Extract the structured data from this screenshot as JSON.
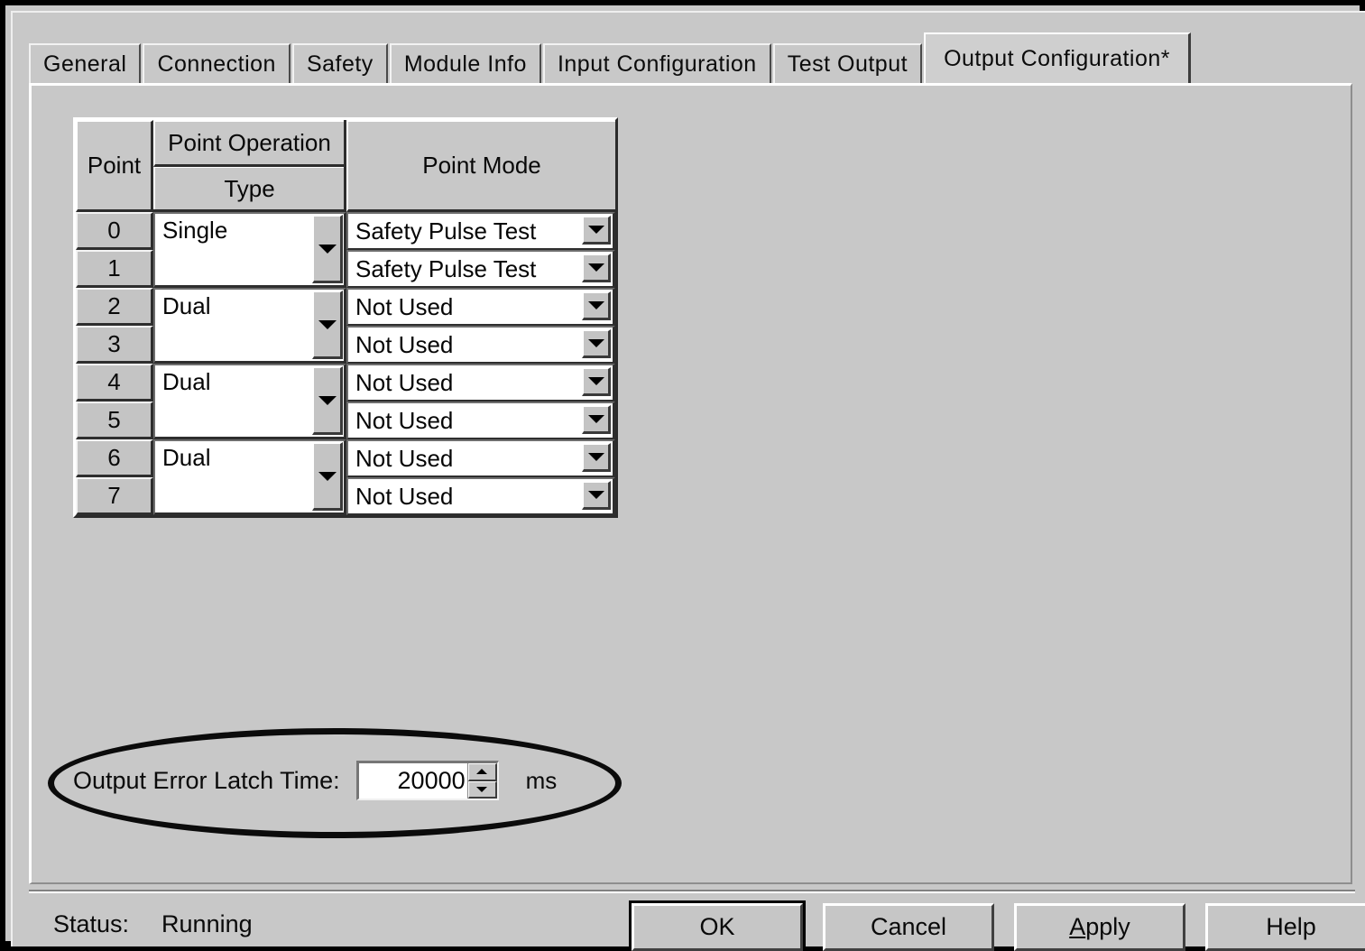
{
  "dialog": {
    "tabs": [
      {
        "label": "General",
        "active": false
      },
      {
        "label": "Connection",
        "active": false
      },
      {
        "label": "Safety",
        "active": false
      },
      {
        "label": "Module Info",
        "active": false
      },
      {
        "label": "Input Configuration",
        "active": false
      },
      {
        "label": "Test Output",
        "active": false
      },
      {
        "label": "Output Configuration*",
        "active": true
      }
    ]
  },
  "grid": {
    "headers": {
      "point": "Point",
      "point_operation": "Point Operation",
      "type": "Type",
      "point_mode": "Point Mode"
    },
    "pairs": [
      {
        "type": "Single",
        "points": [
          "0",
          "1"
        ],
        "modes": [
          "Safety Pulse Test",
          "Safety Pulse Test"
        ]
      },
      {
        "type": "Dual",
        "points": [
          "2",
          "3"
        ],
        "modes": [
          "Not Used",
          "Not Used"
        ]
      },
      {
        "type": "Dual",
        "points": [
          "4",
          "5"
        ],
        "modes": [
          "Not Used",
          "Not Used"
        ]
      },
      {
        "type": "Dual",
        "points": [
          "6",
          "7"
        ],
        "modes": [
          "Not Used",
          "Not Used"
        ]
      }
    ]
  },
  "latch": {
    "label": "Output Error Latch Time:",
    "value": "20000",
    "units": "ms"
  },
  "status": {
    "label": "Status:",
    "value": "Running"
  },
  "buttons": {
    "ok": "OK",
    "cancel": "Cancel",
    "apply_accel": "A",
    "apply_rest": "pply",
    "help": "Help"
  }
}
